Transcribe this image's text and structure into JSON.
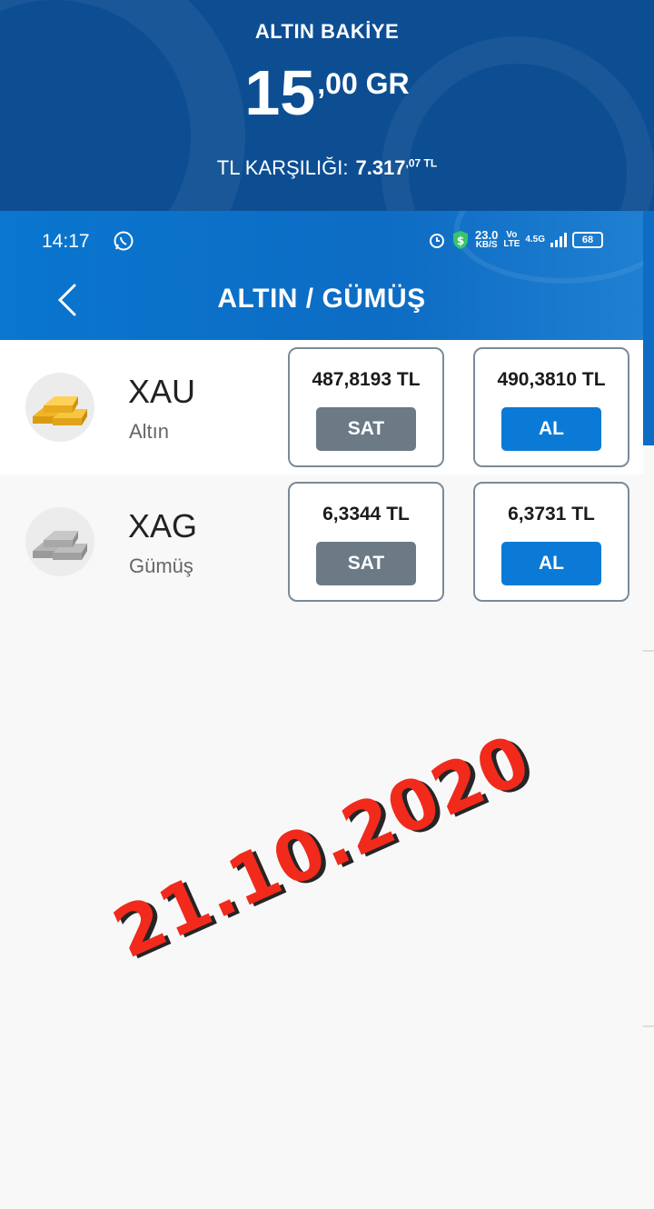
{
  "balance": {
    "title": "ALTIN BAKİYE",
    "amount_integer": "15",
    "amount_decimal": ",00 GR",
    "tl_label": "TL KARŞILIĞI:",
    "tl_value": "7.317",
    "tl_decimal": ",07 TL"
  },
  "status_bar": {
    "time": "14:17",
    "net_speed": "23.0",
    "net_unit": "KB/S",
    "volte": "Vo LTE",
    "network": "4.5G",
    "battery": "68"
  },
  "appbar": {
    "title": "ALTIN / GÜMÜŞ"
  },
  "instruments": [
    {
      "code": "XAU",
      "name": "Altın",
      "sell_price": "487,8193 TL",
      "sell_label": "SAT",
      "buy_price": "490,3810 TL",
      "buy_label": "AL",
      "icon": "gold-bar-icon",
      "color": "#f2b526"
    },
    {
      "code": "XAG",
      "name": "Gümüş",
      "sell_price": "6,3344 TL",
      "sell_label": "SAT",
      "buy_price": "6,3731 TL",
      "buy_label": "AL",
      "icon": "silver-bar-icon",
      "color": "#a8a8a8"
    }
  ],
  "stamp": {
    "date": "21.10.2020"
  },
  "colors": {
    "header_bg": "#0d4e93",
    "appbar_bg": "#0a76cf",
    "sell_button": "#6c7a86",
    "buy_button": "#0a7ad6",
    "stamp": "#f12a1c"
  }
}
